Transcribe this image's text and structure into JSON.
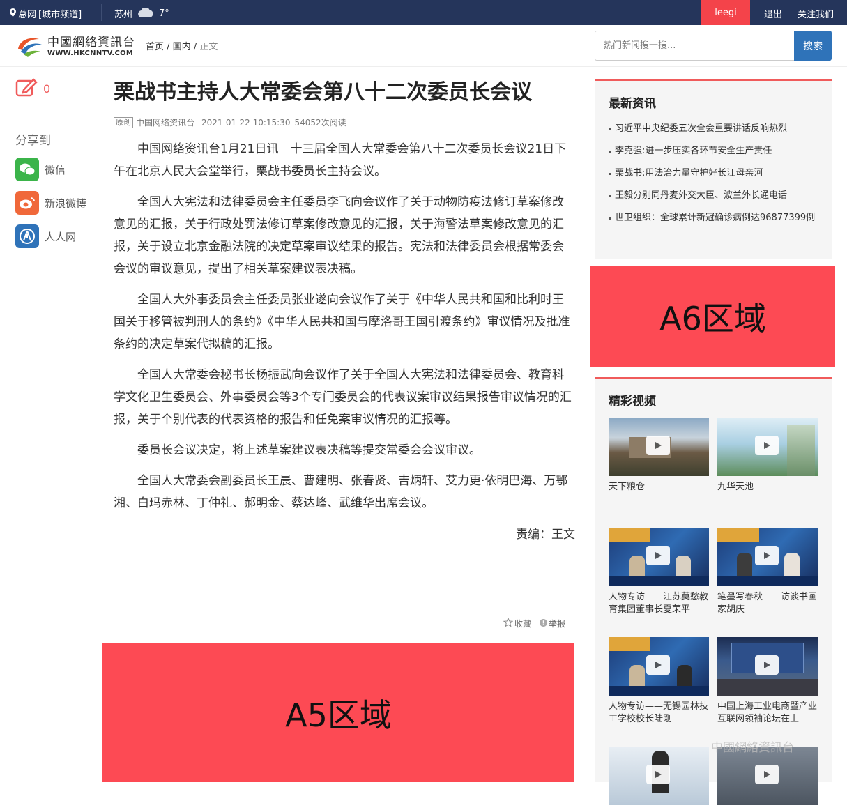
{
  "topbar": {
    "loc": "总网",
    "channel": "[城市频道]",
    "city": "苏州",
    "temp": "7°",
    "user": "leegi",
    "logout": "退出",
    "follow": "关注我们"
  },
  "logo": {
    "cn": "中國網絡資訊台",
    "en": "WWW.HKCNNTV.COM"
  },
  "breadcrumb": {
    "home": "首页",
    "section": "国内",
    "current": "正文"
  },
  "search": {
    "placeholder": "热门新闻搜一搜...",
    "button": "搜索"
  },
  "side": {
    "edit_count": "0",
    "share_label": "分享到",
    "shares": [
      "微信",
      "新浪微博",
      "人人网"
    ]
  },
  "article": {
    "title": "栗战书主持人大常委会第八十二次委员长会议",
    "badge": "原创",
    "source": "中国网络资讯台",
    "datetime": "2021-01-22 10:15:30",
    "reads": "54052次阅读",
    "paragraphs": [
      "中国网络资讯台1月21日讯　十三届全国人大常委会第八十二次委员长会议21日下午在北京人民大会堂举行，栗战书委员长主持会议。",
      "全国人大宪法和法律委员会主任委员李飞向会议作了关于动物防疫法修订草案修改意见的汇报，关于行政处罚法修订草案修改意见的汇报，关于海警法草案修改意见的汇报，关于设立北京金融法院的决定草案审议结果的报告。宪法和法律委员会根据常委会会议的审议意见，提出了相关草案建议表决稿。",
      "全国人大外事委员会主任委员张业遂向会议作了关于《中华人民共和国和比利时王国关于移管被判刑人的条约》《中华人民共和国与摩洛哥王国引渡条约》审议情况及批准条约的决定草案代拟稿的汇报。",
      "全国人大常委会秘书长杨振武向会议作了关于全国人大宪法和法律委员会、教育科学文化卫生委员会、外事委员会等3个专门委员会的代表议案审议结果报告审议情况的汇报，关于个别代表的代表资格的报告和任免案审议情况的汇报等。",
      "委员长会议决定，将上述草案建议表决稿等提交常委会会议审议。",
      "全国人大常委会副委员长王晨、曹建明、张春贤、吉炳轩、艾力更·依明巴海、万鄂湘、白玛赤林、丁仲礼、郝明金、蔡达峰、武维华出席会议。"
    ],
    "editor": "责编：王文",
    "collect": "收藏",
    "report": "举报"
  },
  "ads": {
    "a5": "A5区域",
    "a6": "A6区域"
  },
  "latest": {
    "title": "最新资讯",
    "items": [
      "习近平中央纪委五次全会重要讲话反响热烈",
      "李克强:进一步压实各环节安全生产责任",
      "栗战书:用法治力量守护好长江母亲河",
      "王毅分别同丹麦外交大臣、波兰外长通电话",
      "世卫组织：全球累计新冠确诊病例达96877399例"
    ]
  },
  "videos": {
    "title": "精彩视频",
    "items": [
      "天下粮仓",
      "九华天池",
      "人物专访——江苏莫愁教育集团董事长夏荣平",
      "笔墨写春秋——访谈书画家胡庆",
      "人物专访——无锡园林技工学校校长陆刚",
      "中国上海工业电商暨产业互联网领袖论坛在上",
      "",
      ""
    ]
  },
  "watermark": "中國網絡資訊台",
  "colors": {
    "topbar": "#25355b",
    "accent": "#f4434a",
    "ad": "#fd4a54",
    "search_btn": "#2f73b9"
  }
}
